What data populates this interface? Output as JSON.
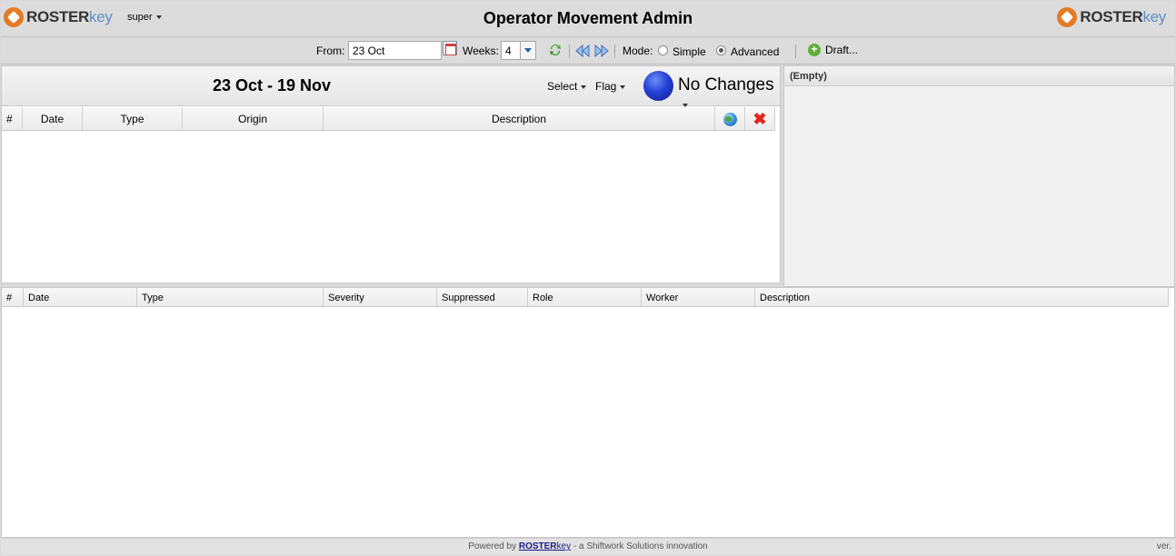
{
  "header": {
    "logo_roster": "ROSTER",
    "logo_key": "key",
    "user": "super",
    "title": "Operator Movement Admin"
  },
  "toolbar": {
    "from_label": "From:",
    "from_value": "23 Oct",
    "weeks_label": "Weeks:",
    "weeks_value": "4",
    "mode_label": "Mode:",
    "mode_simple": "Simple",
    "mode_advanced": "Advanced",
    "mode_selected": "Advanced",
    "draft_label": "Draft..."
  },
  "main": {
    "range_title": "23 Oct - 19 Nov",
    "select_menu": "Select",
    "flag_menu": "Flag",
    "status_text": "No Changes",
    "columns": [
      "#",
      "Date",
      "Type",
      "Origin",
      "Description"
    ],
    "rows": []
  },
  "side_panel": {
    "title": "(Empty)"
  },
  "bottom_grid": {
    "columns": [
      "#",
      "Date",
      "Type",
      "Severity",
      "Suppressed",
      "Role",
      "Worker",
      "Description"
    ],
    "rows": []
  },
  "footer": {
    "powered_by": "Powered by",
    "brand_roster": "ROSTER",
    "brand_key": "key",
    "tagline": "- a Shiftwork Solutions innovation",
    "version_label": "ver."
  },
  "colors": {
    "logo_orange": "#e57a22",
    "logo_blue": "#5b8fc4",
    "status_orb": "#2640d6",
    "delete_red": "#e0261b"
  }
}
